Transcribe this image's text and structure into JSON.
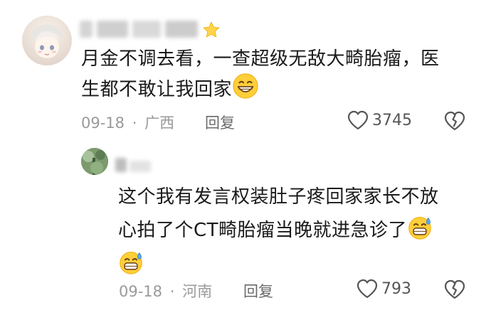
{
  "comment": {
    "text_line1": "月金不调去看，一查超级无敌大畸胎瘤，医",
    "text_line2": "生都不敢让我回家",
    "emoji": "grin-emoji",
    "date": "09-18",
    "dot": "·",
    "location": "广西",
    "reply_label": "回复",
    "likes": "3745"
  },
  "reply": {
    "text_line1": "这个我有发言权装肚子疼回家家长不放",
    "text_line2": "心拍了个CT畸胎瘤当晚就进急诊了",
    "emoji": "sweat-smile-emoji",
    "date": "09-18",
    "dot": "·",
    "location": "河南",
    "reply_label": "回复",
    "likes": "793"
  },
  "colors": {
    "text": "#1a1a1a",
    "meta": "#9a9a9a",
    "icon": "#555555"
  }
}
